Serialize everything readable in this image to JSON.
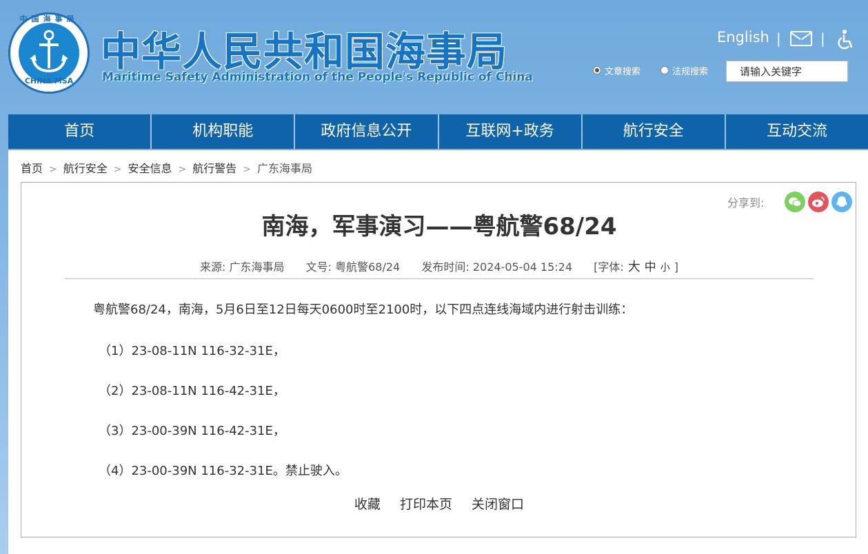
{
  "header": {
    "logo": {
      "top_text": "中国海事局",
      "bottom_text": "CHINA MSA"
    },
    "title_cn": "中华人民共和国海事局",
    "title_en": "Maritime Safety Administration of the People's Republic of China",
    "english_link": "English",
    "separator": "|",
    "icons": [
      "mail-icon",
      "accessibility-icon"
    ],
    "search": {
      "options": [
        "文章搜索",
        "法规搜索"
      ],
      "selected": "文章搜索",
      "placeholder": "请输入关键字"
    }
  },
  "nav": {
    "items": [
      {
        "label": "首页"
      },
      {
        "label": "机构职能"
      },
      {
        "label": "政府信息公开"
      },
      {
        "label": "互联网+政务"
      },
      {
        "label": "航行安全"
      },
      {
        "label": "互动交流"
      }
    ]
  },
  "breadcrumb": {
    "items": [
      "首页",
      "航行安全",
      "安全信息",
      "航行警告",
      "广东海事局"
    ],
    "separator": ">"
  },
  "article": {
    "share_label": "分享到:",
    "share_targets": [
      "wechat",
      "weibo",
      "qq"
    ],
    "title": "南海，军事演习——粤航警68/24",
    "meta": {
      "source_label": "来源:",
      "source": "广东海事局",
      "doc_no_label": "文号:",
      "doc_no": "粤航警68/24",
      "publish_label": "发布时间:",
      "publish_time": "2024-05-04 15:24",
      "font_label_open": "[字体:",
      "font_big": "大",
      "font_mid": "中",
      "font_small": "小",
      "font_label_close": "]"
    },
    "lead": "粤航警68/24，南海，5月6日至12日每天0600时至2100时，以下四点连线海域内进行射击训练：",
    "points": [
      "（1）23-08-11N 116-32-31E，",
      "（2）23-08-11N 116-42-31E，",
      "（3）23-00-39N 116-42-31E，",
      "（4）23-00-39N 116-32-31E。禁止驶入。"
    ],
    "actions": {
      "favorite": "收藏",
      "print": "打印本页",
      "close": "关闭窗口"
    }
  },
  "colors": {
    "nav_bg": "#0f63a8",
    "brand_blue": "#1574c4",
    "header_gradient_top": "#6fa9dd"
  }
}
